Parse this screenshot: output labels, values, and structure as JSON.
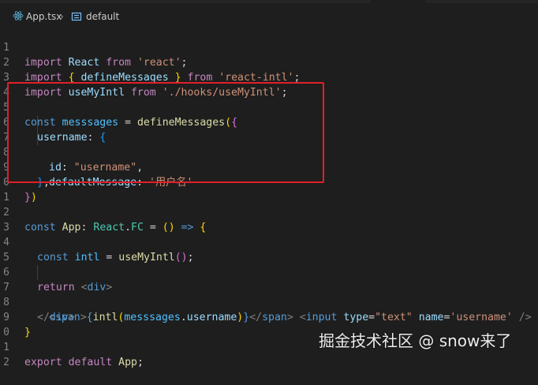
{
  "breadcrumb": {
    "file_name": "App.tsx",
    "separator": "›",
    "symbol_name": "default"
  },
  "line_numbers": [
    "1",
    "2",
    "3",
    "4",
    "5",
    "6",
    "7",
    "8",
    "9",
    "0",
    "1",
    "2",
    "3",
    "4",
    "5",
    "6",
    "7",
    "8",
    "9",
    "0",
    "1",
    "2"
  ],
  "code": {
    "l1": [
      "import",
      " React ",
      "from",
      " ",
      "'react'",
      ";"
    ],
    "l2": [
      "import",
      " ",
      "{",
      " defineMessages ",
      "}",
      " ",
      "from",
      " ",
      "'react-intl'",
      ";"
    ],
    "l3": [
      "import",
      " useMyIntl ",
      "from",
      " ",
      "'./hooks/useMyIntl'",
      ";"
    ],
    "l5": [
      "const",
      " ",
      "messsages",
      " = ",
      "defineMessages",
      "(",
      "{"
    ],
    "l6": [
      "username",
      ": ",
      "{"
    ],
    "l7": [
      "id",
      ": ",
      "\"username\"",
      ","
    ],
    "l8": [
      "defaultMessage",
      ": ",
      "'用户名'"
    ],
    "l9": [
      "}",
      ","
    ],
    "l10": [
      "}",
      ")"
    ],
    "l12": [
      "const",
      " ",
      "App",
      ": ",
      "React",
      ".",
      "FC",
      " = ",
      "()",
      " => ",
      "{"
    ],
    "l14": [
      "const",
      " ",
      "intl",
      " = ",
      "useMyIntl",
      "()",
      ";"
    ],
    "l16": [
      "return",
      " ",
      "<",
      "div",
      ">"
    ],
    "l17": [
      "<",
      "span",
      ">",
      "{",
      "intl",
      "(",
      "messsages",
      ".",
      "username",
      ")",
      "}",
      "</",
      "span",
      ">",
      " ",
      "<",
      "input",
      " ",
      "type",
      "=",
      "\"text\"",
      " ",
      "name",
      "=",
      "'username'",
      " />"
    ],
    "l18": [
      "</",
      "div",
      ">"
    ],
    "l19": [
      "}"
    ],
    "l21": [
      "export",
      " ",
      "default",
      " ",
      "App",
      ";"
    ]
  },
  "watermark": "掘金技术社区 @ snow来了",
  "colors": {
    "background": "#1e1e1e",
    "highlight_box": "#e0202a"
  }
}
